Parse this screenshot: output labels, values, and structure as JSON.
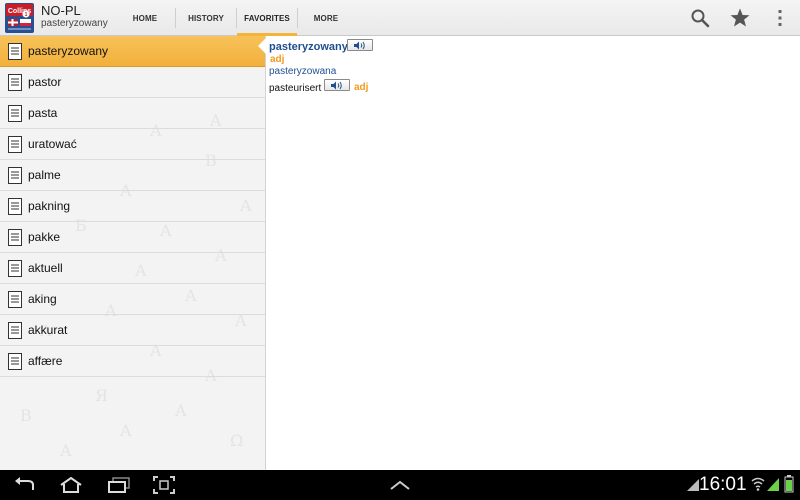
{
  "app": {
    "title": "NO-PL",
    "subtitle": "pasteryzowany",
    "icon": "collins-dictionary-icon",
    "icon_text": "Collins"
  },
  "tabs": [
    {
      "label": "HOME",
      "selected": false
    },
    {
      "label": "HISTORY",
      "selected": false
    },
    {
      "label": "FAVORITES",
      "selected": true
    },
    {
      "label": "MORE",
      "selected": false
    }
  ],
  "actions": {
    "search": "search-icon",
    "favorite": "star-icon",
    "overflow": "overflow-menu-icon"
  },
  "list": {
    "items": [
      {
        "label": "pasteryzowany",
        "selected": true
      },
      {
        "label": "pastor",
        "selected": false
      },
      {
        "label": "pasta",
        "selected": false
      },
      {
        "label": "uratować",
        "selected": false
      },
      {
        "label": "palme",
        "selected": false
      },
      {
        "label": "pakning",
        "selected": false
      },
      {
        "label": "pakke",
        "selected": false
      },
      {
        "label": "aktuell",
        "selected": false
      },
      {
        "label": "aking",
        "selected": false
      },
      {
        "label": "akkurat",
        "selected": false
      },
      {
        "label": "affære",
        "selected": false
      }
    ]
  },
  "entry": {
    "headword": "pasteryzowany",
    "pos": "adj",
    "feminine_form": "pasteryzowana",
    "translation": "pasteurisert",
    "translation_pos": "adj",
    "audio_icon": "speaker-icon"
  },
  "systembar": {
    "time": "16:01"
  },
  "colors": {
    "accent": "#f4b43c",
    "headword": "#1f4f8f",
    "pos": "#f29a1e"
  }
}
